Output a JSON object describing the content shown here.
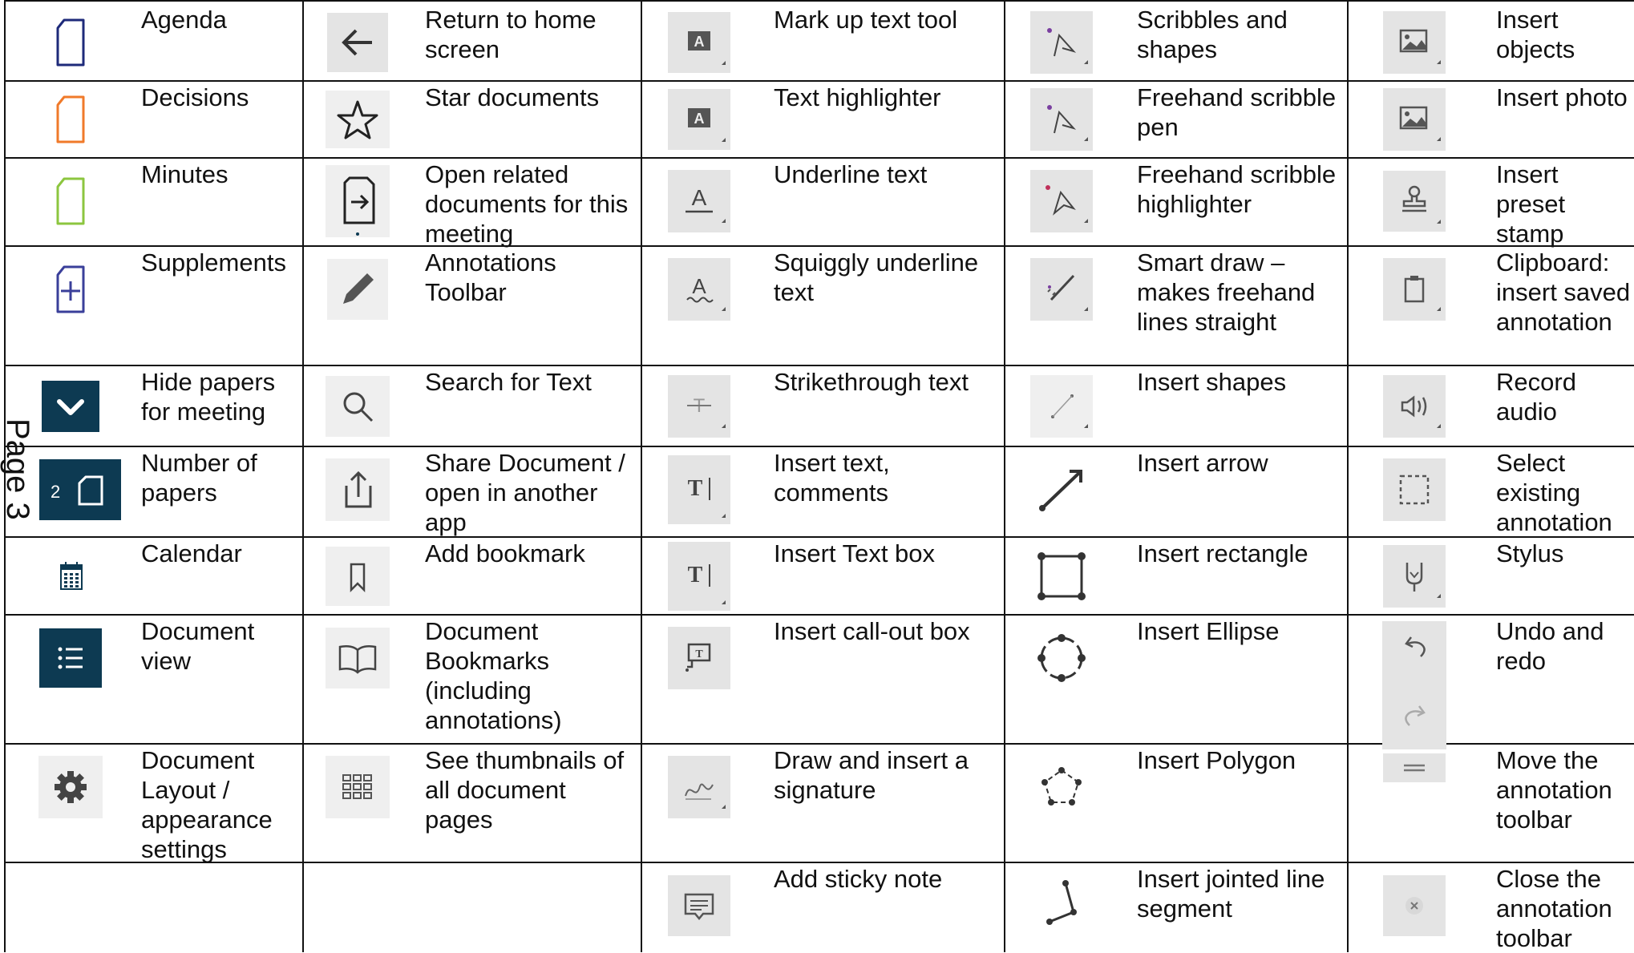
{
  "page_label": "Page 3",
  "colors": {
    "agenda": "#1e2a7a",
    "decisions": "#f07a2a",
    "minutes": "#8cc63f",
    "supplements": "#3a3f9a",
    "dark_tile": "#0d3a52",
    "tile_grey": "#e4e4e4"
  },
  "columns": [
    {
      "rows": [
        {
          "icon": "agenda-document-icon",
          "label": "Agenda"
        },
        {
          "icon": "decisions-document-icon",
          "label": "Decisions"
        },
        {
          "icon": "minutes-document-icon",
          "label": "Minutes"
        },
        {
          "icon": "supplements-document-plus-icon",
          "label": "Supplements"
        },
        {
          "icon": "chevron-down-icon",
          "label": "Hide papers for meeting"
        },
        {
          "icon": "paper-count-icon",
          "label": "Number of papers",
          "badge": "2"
        },
        {
          "icon": "calendar-icon",
          "label": "Calendar"
        },
        {
          "icon": "list-view-icon",
          "label": "Document view"
        },
        {
          "icon": "gear-icon",
          "label": "Document Layout / appearance settings"
        },
        {
          "icon": "",
          "label": ""
        }
      ]
    },
    {
      "rows": [
        {
          "icon": "arrow-left-icon",
          "label": "Return to home screen"
        },
        {
          "icon": "star-icon",
          "label": "Star documents"
        },
        {
          "icon": "open-related-icon",
          "label": "Open related documents for this meeting"
        },
        {
          "icon": "pencil-icon",
          "label": "Annotations Toolbar"
        },
        {
          "icon": "search-icon",
          "label": "Search for Text"
        },
        {
          "icon": "share-icon",
          "label": "Share Document / open in another app"
        },
        {
          "icon": "bookmark-icon",
          "label": "Add bookmark"
        },
        {
          "icon": "book-open-icon",
          "label": "Document Bookmarks (including annotations)"
        },
        {
          "icon": "thumbnails-grid-icon",
          "label": "See thumbnails of all document pages"
        },
        {
          "icon": "",
          "label": ""
        }
      ]
    },
    {
      "rows": [
        {
          "icon": "markup-text-icon",
          "label": "Mark up text tool"
        },
        {
          "icon": "text-highlighter-icon",
          "label": "Text highlighter"
        },
        {
          "icon": "underline-text-icon",
          "label": "Underline text"
        },
        {
          "icon": "squiggly-underline-icon",
          "label": "Squiggly underline text"
        },
        {
          "icon": "strikethrough-icon",
          "label": "Strikethrough text"
        },
        {
          "icon": "insert-text-icon",
          "label": "Insert text, comments"
        },
        {
          "icon": "text-box-icon",
          "label": "Insert Text box"
        },
        {
          "icon": "callout-box-icon",
          "label": "Insert call-out box"
        },
        {
          "icon": "signature-icon",
          "label": "Draw and insert a signature"
        },
        {
          "icon": "sticky-note-icon",
          "label": "Add sticky note"
        }
      ]
    },
    {
      "rows": [
        {
          "icon": "scribble-shapes-icon",
          "label": "Scribbles and shapes"
        },
        {
          "icon": "scribble-pen-icon",
          "label": "Freehand scribble pen"
        },
        {
          "icon": "scribble-highlighter-icon",
          "label": "Freehand scribble highlighter"
        },
        {
          "icon": "smart-draw-icon",
          "label": "Smart draw – makes freehand lines straight"
        },
        {
          "icon": "insert-shapes-icon",
          "label": "Insert shapes"
        },
        {
          "icon": "arrow-icon",
          "label": "Insert arrow"
        },
        {
          "icon": "rectangle-icon",
          "label": "Insert rectangle"
        },
        {
          "icon": "ellipse-icon",
          "label": "Insert Ellipse"
        },
        {
          "icon": "polygon-icon",
          "label": "Insert Polygon"
        },
        {
          "icon": "jointed-line-icon",
          "label": "Insert jointed line segment"
        }
      ]
    },
    {
      "rows": [
        {
          "icon": "insert-objects-icon",
          "label": "Insert objects"
        },
        {
          "icon": "insert-photo-icon",
          "label": "Insert photo"
        },
        {
          "icon": "stamp-icon",
          "label": "Insert preset stamp"
        },
        {
          "icon": "clipboard-icon",
          "label": "Clipboard: insert saved annotation"
        },
        {
          "icon": "record-audio-icon",
          "label": "Record audio"
        },
        {
          "icon": "select-annotation-icon",
          "label": "Select existing annotation"
        },
        {
          "icon": "stylus-icon",
          "label": "Stylus"
        },
        {
          "icon": "undo-redo-icon",
          "label": "Undo and redo"
        },
        {
          "icon": "move-toolbar-icon",
          "label": "Move the annotation toolbar"
        },
        {
          "icon": "close-toolbar-icon",
          "label": "Close the annotation toolbar"
        }
      ]
    }
  ]
}
